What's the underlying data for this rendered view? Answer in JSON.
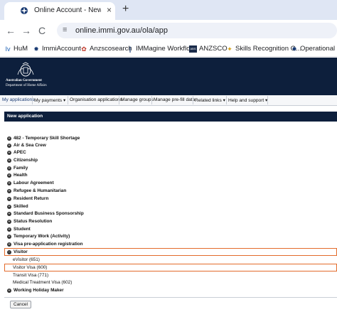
{
  "browser": {
    "tab_title": "Online Account - New applicati",
    "tab_close": "×",
    "new_tab": "+",
    "url": "online.immi.gov.au/ola/app",
    "nav": {
      "back": "←",
      "forward": "→",
      "reload": "C",
      "site_icon": "≡"
    }
  },
  "bookmarks": [
    {
      "label": "HuM",
      "icon": "Iv",
      "color": "#1a5fb4"
    },
    {
      "label": "ImmiAccount",
      "icon": "✸",
      "color": "#1a3b73"
    },
    {
      "label": "Anzscosearch",
      "icon": "✿",
      "color": "#c0392b"
    },
    {
      "label": "IMMagine Workflo...",
      "icon": "|",
      "color": "#1a3b73"
    },
    {
      "label": "ANZSCO",
      "icon": "ABS",
      "color": "#1a2b4a"
    },
    {
      "label": "Skills Recognition G...",
      "icon": "✦",
      "color": "#d4a017"
    },
    {
      "label": "Operational Ma",
      "icon": "✸",
      "color": "#1a3b73"
    }
  ],
  "header": {
    "gov_line1": "Australian Government",
    "gov_line2": "Department of Home Affairs"
  },
  "menu": [
    {
      "label": "My applications"
    },
    {
      "label": "My payments ▾"
    },
    {
      "label": "Organisation applications"
    },
    {
      "label": "Manage groups"
    },
    {
      "label": "Manage pre-fill data"
    },
    {
      "label": "Related links ▾"
    },
    {
      "label": "Help and support ▾"
    }
  ],
  "page_title": "New application",
  "categories": [
    {
      "label": "482 - Temporary Skill Shortage",
      "plus": "+"
    },
    {
      "label": "Air & Sea Crew",
      "plus": "+"
    },
    {
      "label": "APEC",
      "plus": "+"
    },
    {
      "label": "Citizenship",
      "plus": "+"
    },
    {
      "label": "Family",
      "plus": "+"
    },
    {
      "label": "Health",
      "plus": "+"
    },
    {
      "label": "Labour Agreement",
      "plus": "+"
    },
    {
      "label": "Refugee & Humanitarian",
      "plus": "+"
    },
    {
      "label": "Resident Return",
      "plus": "+"
    },
    {
      "label": "Skilled",
      "plus": "+"
    },
    {
      "label": "Standard Business Sponsorship",
      "plus": "+"
    },
    {
      "label": "Status Resolution",
      "plus": "+"
    },
    {
      "label": "Student",
      "plus": "+"
    },
    {
      "label": "Temporary Work (Activity)",
      "plus": "+"
    },
    {
      "label": "Visa pre-application registration",
      "plus": "+"
    },
    {
      "label": "Visitor",
      "plus": "−"
    }
  ],
  "visitor_options": [
    {
      "label": "eVisitor (651)"
    },
    {
      "label": "Visitor Visa (600)"
    },
    {
      "label": "Transit Visa (771)"
    },
    {
      "label": "Medical Treatment Visa (602)"
    }
  ],
  "after_categories": [
    {
      "label": "Working Holiday Maker",
      "plus": "+"
    }
  ],
  "cancel_label": "Cancel",
  "colors": {
    "header_bg": "#0d1f3c",
    "highlight": "#e36b2b"
  }
}
